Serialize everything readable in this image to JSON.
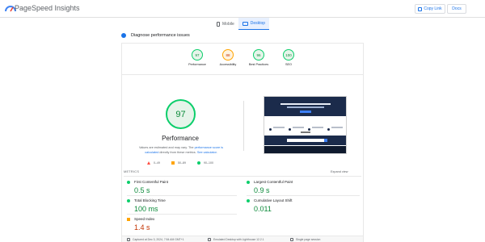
{
  "app": {
    "title": "PageSpeed Insights"
  },
  "header": {
    "copy_link": "Copy Link",
    "docs": "Docs"
  },
  "device_tabs": [
    {
      "label": "Mobile",
      "icon": "phone-icon",
      "active": false
    },
    {
      "label": "Desktop",
      "icon": "monitor-icon",
      "active": true
    }
  ],
  "diagnose": {
    "label": "Diagnose performance issues"
  },
  "scores": [
    {
      "value": "97",
      "label": "Performance",
      "status": "good"
    },
    {
      "value": "88",
      "label": "Accessibility",
      "status": "average"
    },
    {
      "value": "96",
      "label": "Best Practices",
      "status": "good"
    },
    {
      "value": "100",
      "label": "SEO",
      "status": "good"
    }
  ],
  "performance": {
    "score": "97",
    "title": "Performance",
    "note_prefix": "Values are estimated and may vary. The ",
    "note_link1": "performance score is calculated",
    "note_mid": " directly from these metrics. ",
    "note_link2": "See calculator",
    "note_suffix": "."
  },
  "legend": [
    {
      "range": "0–49",
      "shape": "triangle",
      "color": "#ff4e42"
    },
    {
      "range": "50–89",
      "shape": "square",
      "color": "#ffa400"
    },
    {
      "range": "90–100",
      "shape": "circle",
      "color": "#0cce6b"
    }
  ],
  "metrics": {
    "section_label": "METRICS",
    "expand_label": "Expand view",
    "items": [
      {
        "name": "First Contentful Paint",
        "value": "0.5 s",
        "status": "good"
      },
      {
        "name": "Largest Contentful Paint",
        "value": "0.9 s",
        "status": "good"
      },
      {
        "name": "Total Blocking Time",
        "value": "100 ms",
        "status": "good"
      },
      {
        "name": "Cumulative Layout Shift",
        "value": "0.011",
        "status": "good"
      },
      {
        "name": "Speed Index",
        "value": "1.4 s",
        "status": "average"
      }
    ]
  },
  "footer": {
    "captured": "Captured at Dec 3, 2024, 7:54 AM GMT+1",
    "emulated": "Emulated Desktop with Lighthouse 12.2.1",
    "session": "Single page session"
  },
  "colors": {
    "good": "#0cce6b",
    "average": "#ffa400",
    "poor": "#ff4e42",
    "accent": "#1a73e8"
  }
}
